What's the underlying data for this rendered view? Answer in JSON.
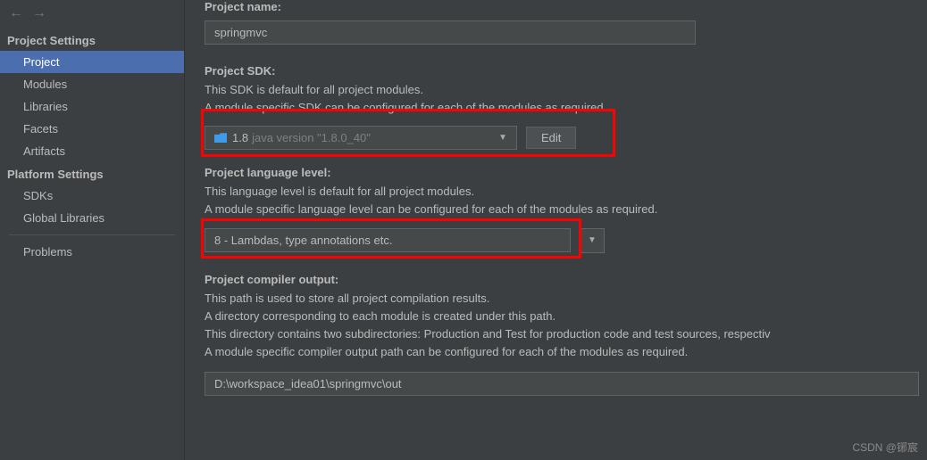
{
  "nav": {
    "back": "←",
    "forward": "→"
  },
  "sidebar": {
    "section1": "Project Settings",
    "items1": [
      "Project",
      "Modules",
      "Libraries",
      "Facets",
      "Artifacts"
    ],
    "section2": "Platform Settings",
    "items2": [
      "SDKs",
      "Global Libraries"
    ],
    "problems": "Problems"
  },
  "main": {
    "projectNameLabel": "Project name:",
    "projectName": "springmvc",
    "sdkLabel": "Project SDK:",
    "sdkDesc1": "This SDK is default for all project modules.",
    "sdkDesc2": "A module specific SDK can be configured for each of the modules as required.",
    "sdkValue": "1.8",
    "sdkVersion": "java version \"1.8.0_40\"",
    "editBtn": "Edit",
    "langLabel": "Project language level:",
    "langDesc1": "This language level is default for all project modules.",
    "langDesc2": "A module specific language level can be configured for each of the modules as required.",
    "langValue": "8 - Lambdas, type annotations etc.",
    "outLabel": "Project compiler output:",
    "outDesc1": "This path is used to store all project compilation results.",
    "outDesc2": "A directory corresponding to each module is created under this path.",
    "outDesc3": "This directory contains two subdirectories: Production and Test for production code and test sources, respectiv",
    "outDesc4": "A module specific compiler output path can be configured for each of the modules as required.",
    "outPath": "D:\\workspace_idea01\\springmvc\\out"
  },
  "watermark": "CSDN @铘宸"
}
